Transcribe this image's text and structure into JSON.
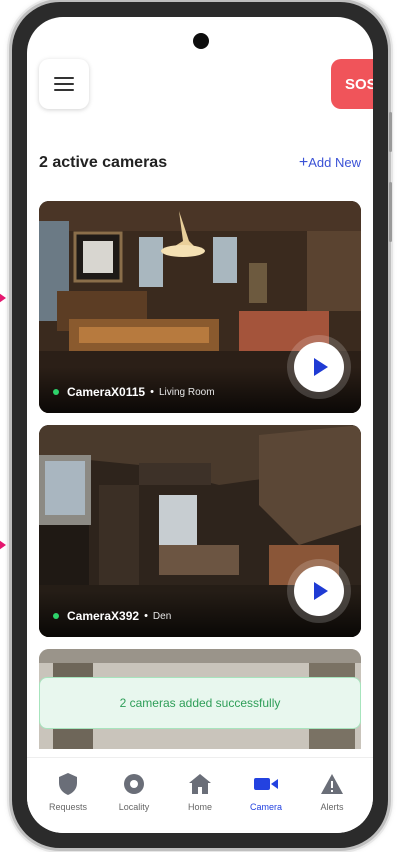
{
  "header": {
    "sos_label": "SOS",
    "active_cameras_title": "2 active cameras",
    "add_new_label": "Add New",
    "add_new_plus": "+"
  },
  "cameras": [
    {
      "name": "CameraX0115",
      "separator": "•",
      "room": "Living Room"
    },
    {
      "name": "CameraX392",
      "separator": "•",
      "room": "Den"
    }
  ],
  "toast": {
    "message": "2 cameras added successfully"
  },
  "bottom_nav": {
    "items": [
      {
        "label": "Requests",
        "icon": "shield-icon",
        "active": false
      },
      {
        "label": "Locality",
        "icon": "locality-icon",
        "active": false
      },
      {
        "label": "Home",
        "icon": "home-icon",
        "active": false
      },
      {
        "label": "Camera",
        "icon": "camera-icon",
        "active": true
      },
      {
        "label": "Alerts",
        "icon": "alert-icon",
        "active": false
      }
    ]
  },
  "colors": {
    "accent": "#2342e0",
    "sos": "#f0545a",
    "success_text": "#2e9e58",
    "success_bg": "#e8f7ee",
    "live_dot": "#2ed36b",
    "pointer": "#e5176f"
  }
}
